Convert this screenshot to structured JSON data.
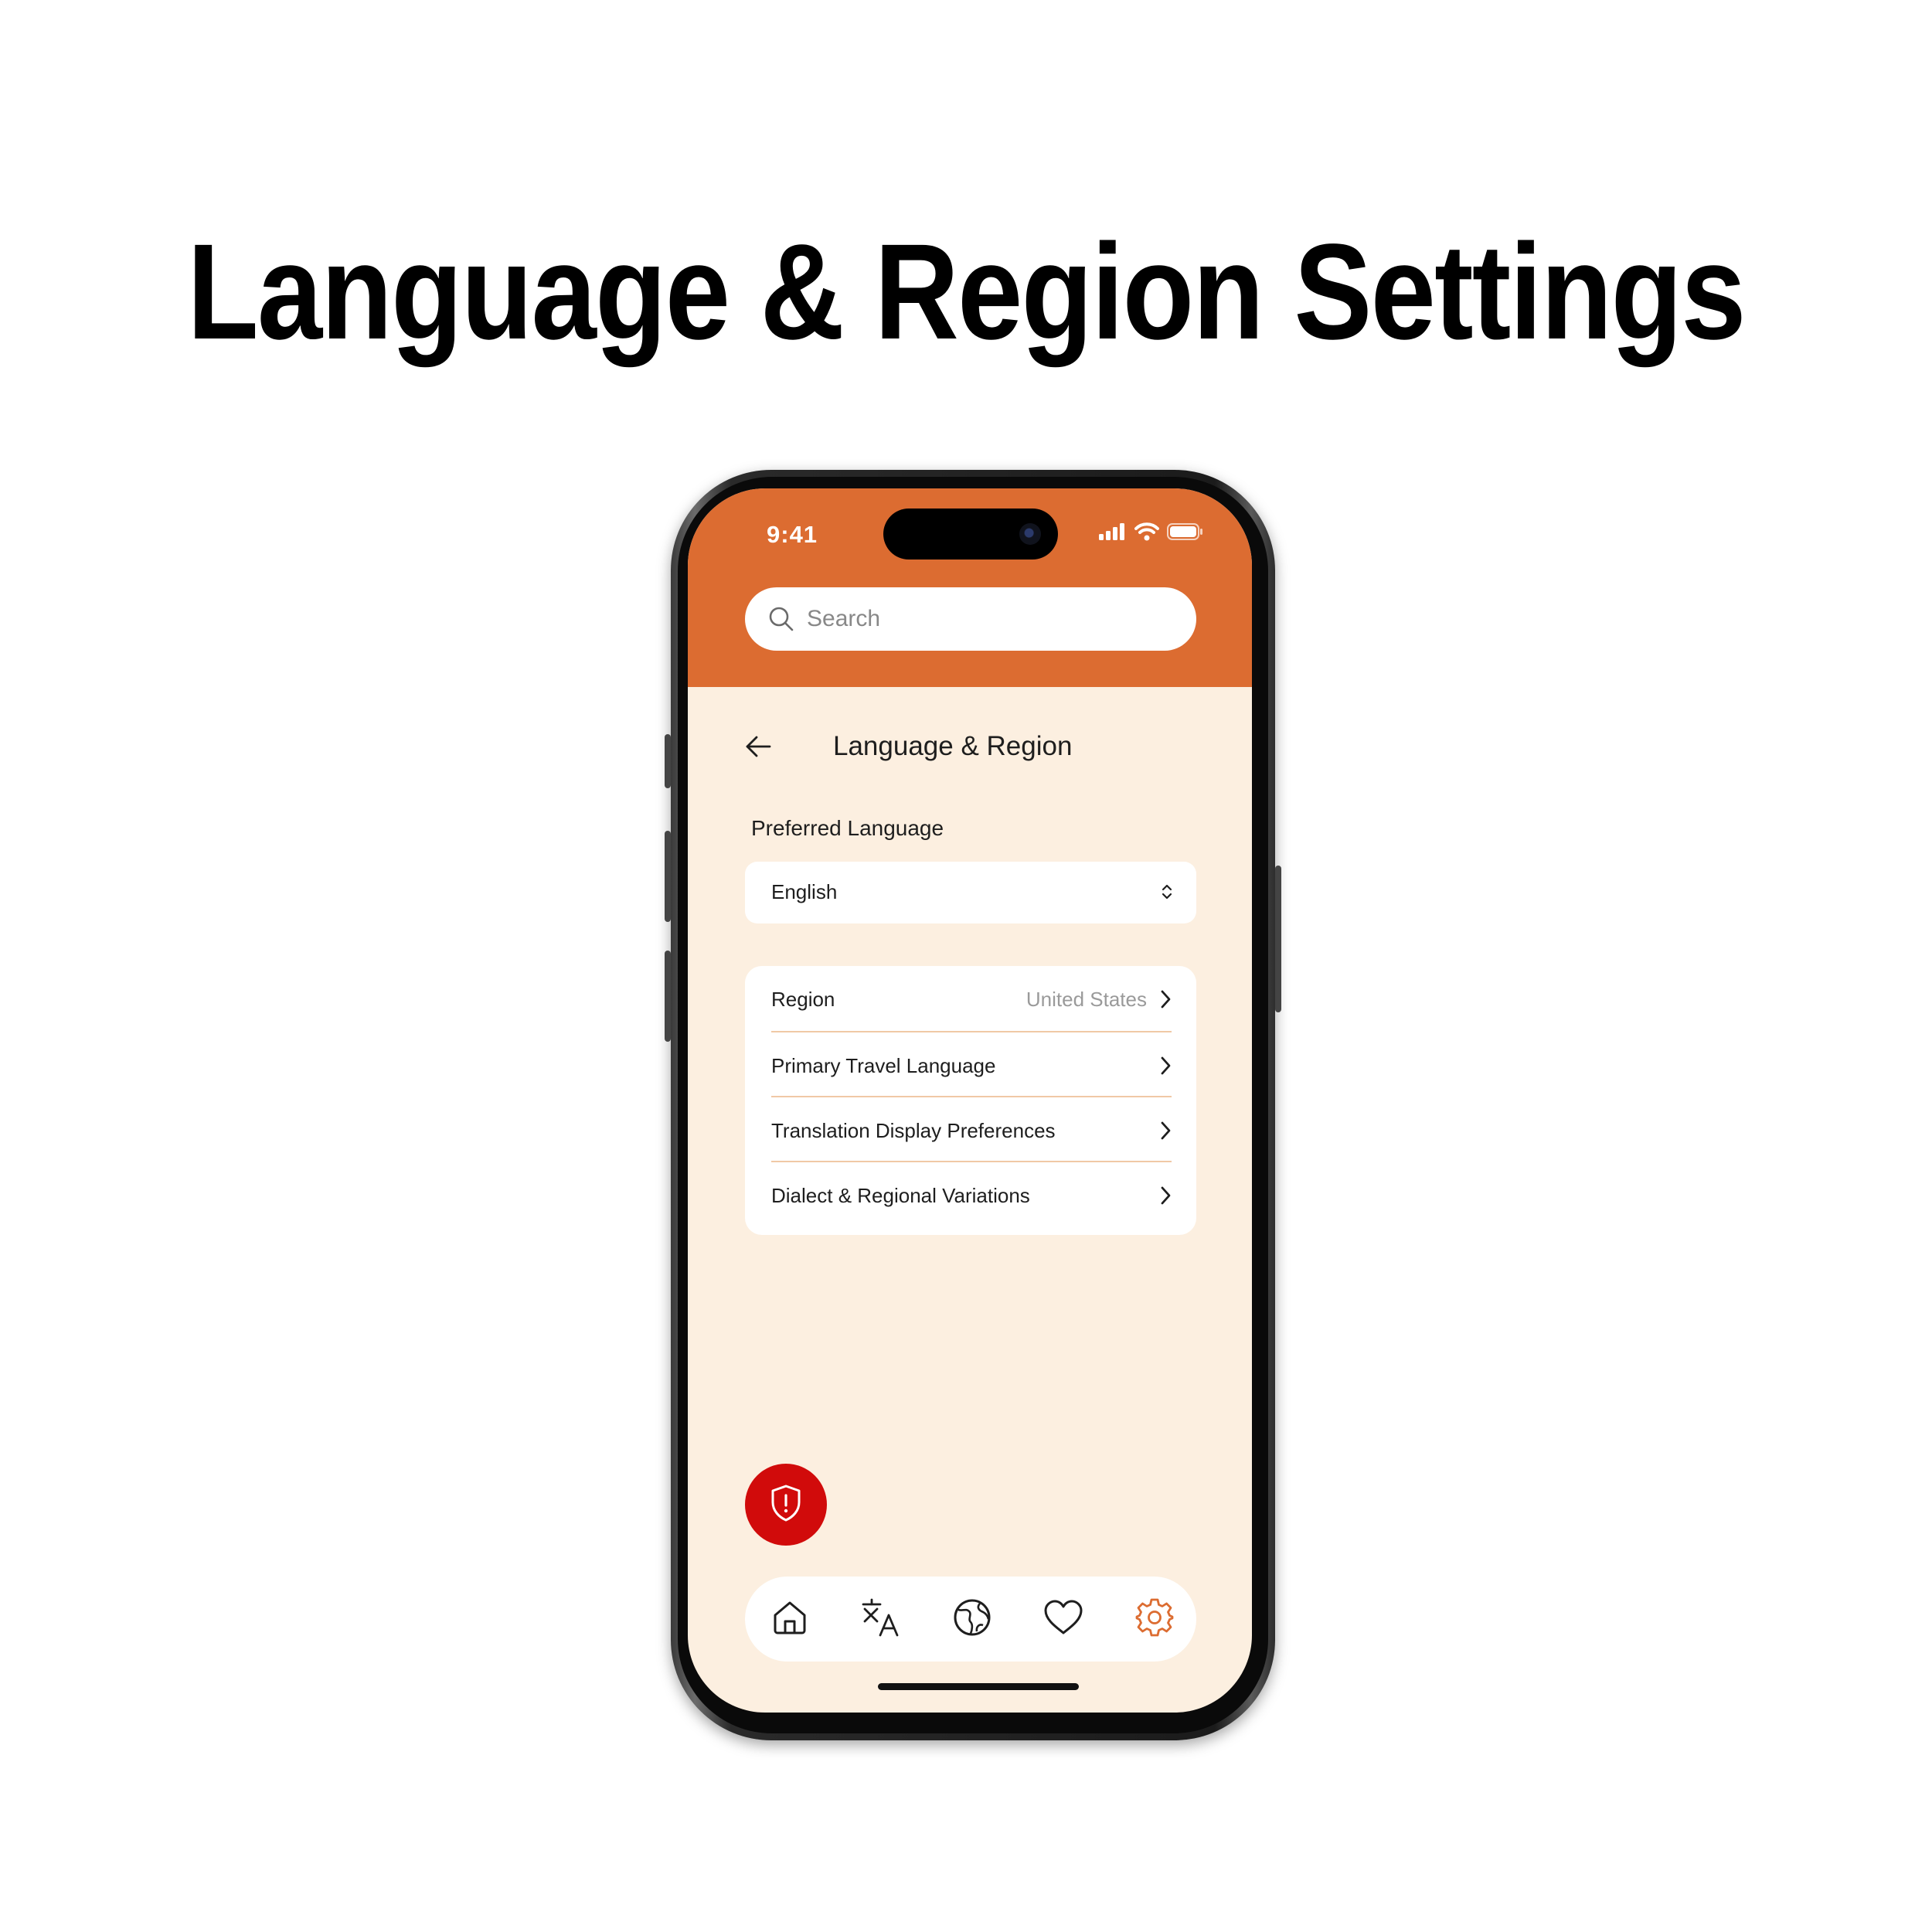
{
  "headline": "Language & Region Settings",
  "colors": {
    "accent": "#dc6c31",
    "screen_bg": "#fcefe0",
    "sos": "#d10b0b",
    "active_tab": "#dc6c31"
  },
  "status_bar": {
    "time": "9:41",
    "icons": [
      "cellular-signal-icon",
      "wifi-icon",
      "battery-icon"
    ]
  },
  "search": {
    "placeholder": "Search",
    "value": ""
  },
  "header": {
    "title": "Language & Region",
    "back_icon": "arrow-left-icon"
  },
  "preferred_language": {
    "label": "Preferred Language",
    "selected": "English"
  },
  "settings_list": [
    {
      "label": "Region",
      "value": "United States"
    },
    {
      "label": "Primary Travel Language",
      "value": ""
    },
    {
      "label": "Translation Display Preferences",
      "value": ""
    },
    {
      "label": "Dialect & Regional Variations",
      "value": ""
    }
  ],
  "emergency_button": {
    "icon": "shield-alert-icon"
  },
  "tab_bar": {
    "tabs": [
      {
        "icon": "home-icon",
        "active": false
      },
      {
        "icon": "translate-icon",
        "active": false
      },
      {
        "icon": "globe-icon",
        "active": false
      },
      {
        "icon": "heart-icon",
        "active": false
      },
      {
        "icon": "gear-icon",
        "active": true
      }
    ]
  }
}
